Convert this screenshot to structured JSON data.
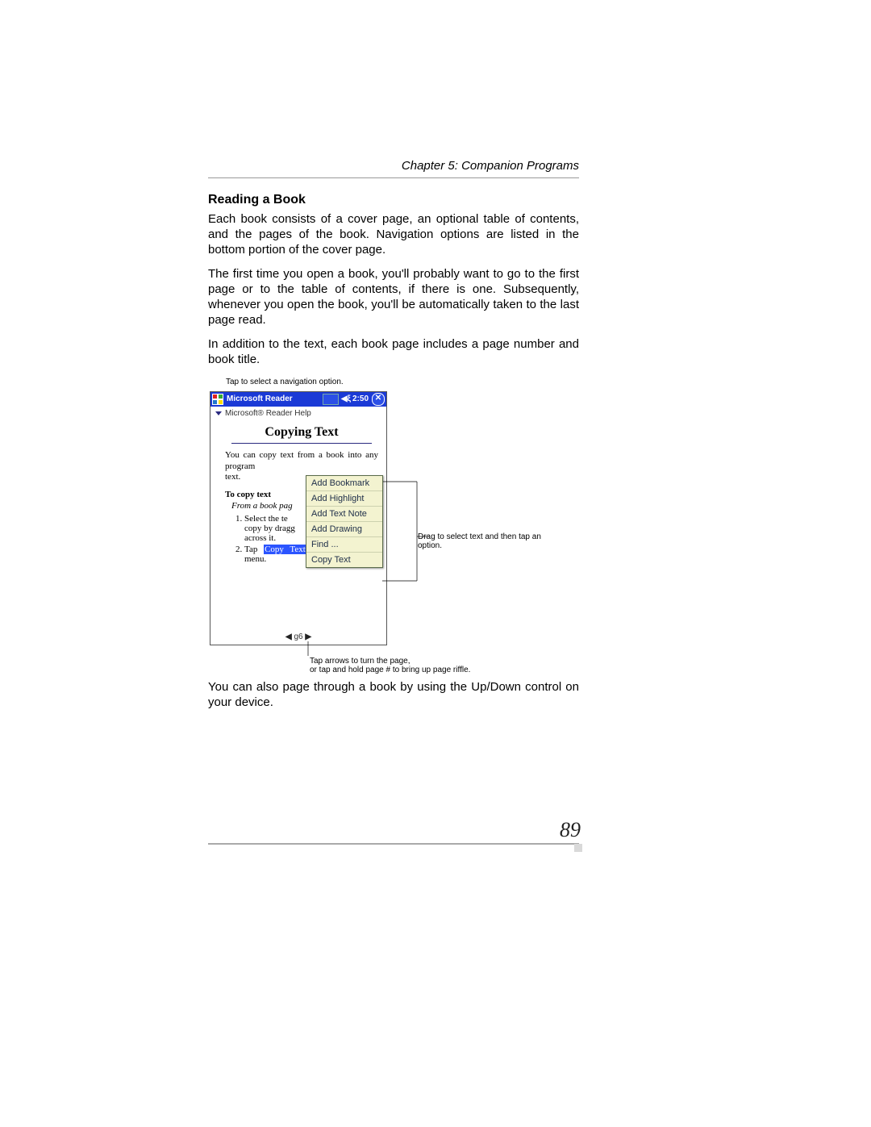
{
  "chapter_header": "Chapter 5: Companion Programs",
  "section_heading": "Reading a Book",
  "para1": "Each book consists of a cover page, an optional table of contents, and the pages of the book. Navigation options are listed in the bottom portion of the cover page.",
  "para2": "The first time you open a book, you'll probably want to go to the first page or to the table of contents, if there is one. Subsequently, whenever you open the book, you'll be automatically taken to the last page read.",
  "para3": "In addition to the text, each book page includes a page number and book title.",
  "callout_top": "Tap to select a navigation option.",
  "titlebar": {
    "app": "Microsoft Reader",
    "time": "2:50"
  },
  "breadcrumb": "Microsoft® Reader Help",
  "reader": {
    "heading": "Copying Text",
    "para": "You can copy text from a book into any program",
    "para_tail": "text.",
    "h2": "To copy text",
    "em": "From a book pag",
    "step1a": "Select the te",
    "step1b": "copy by dragg",
    "step1c": "across it.",
    "step2a": "Tap ",
    "step2_hl": "Copy Text",
    "step2b": " from the pop-up menu.",
    "pager_label": "g6"
  },
  "popup_items": [
    "Add Bookmark",
    "Add Highlight",
    "Add Text Note",
    "Add Drawing",
    "Find ...",
    "Copy Text"
  ],
  "callout_side": "Drag to select text and then tap an option.",
  "callout_bottom_l1": "Tap arrows to turn the page,",
  "callout_bottom_l2": "or tap and hold page # to bring up page riffle.",
  "para_after": "You can also page through a book by using the Up/Down control on your device.",
  "page_number": "89"
}
